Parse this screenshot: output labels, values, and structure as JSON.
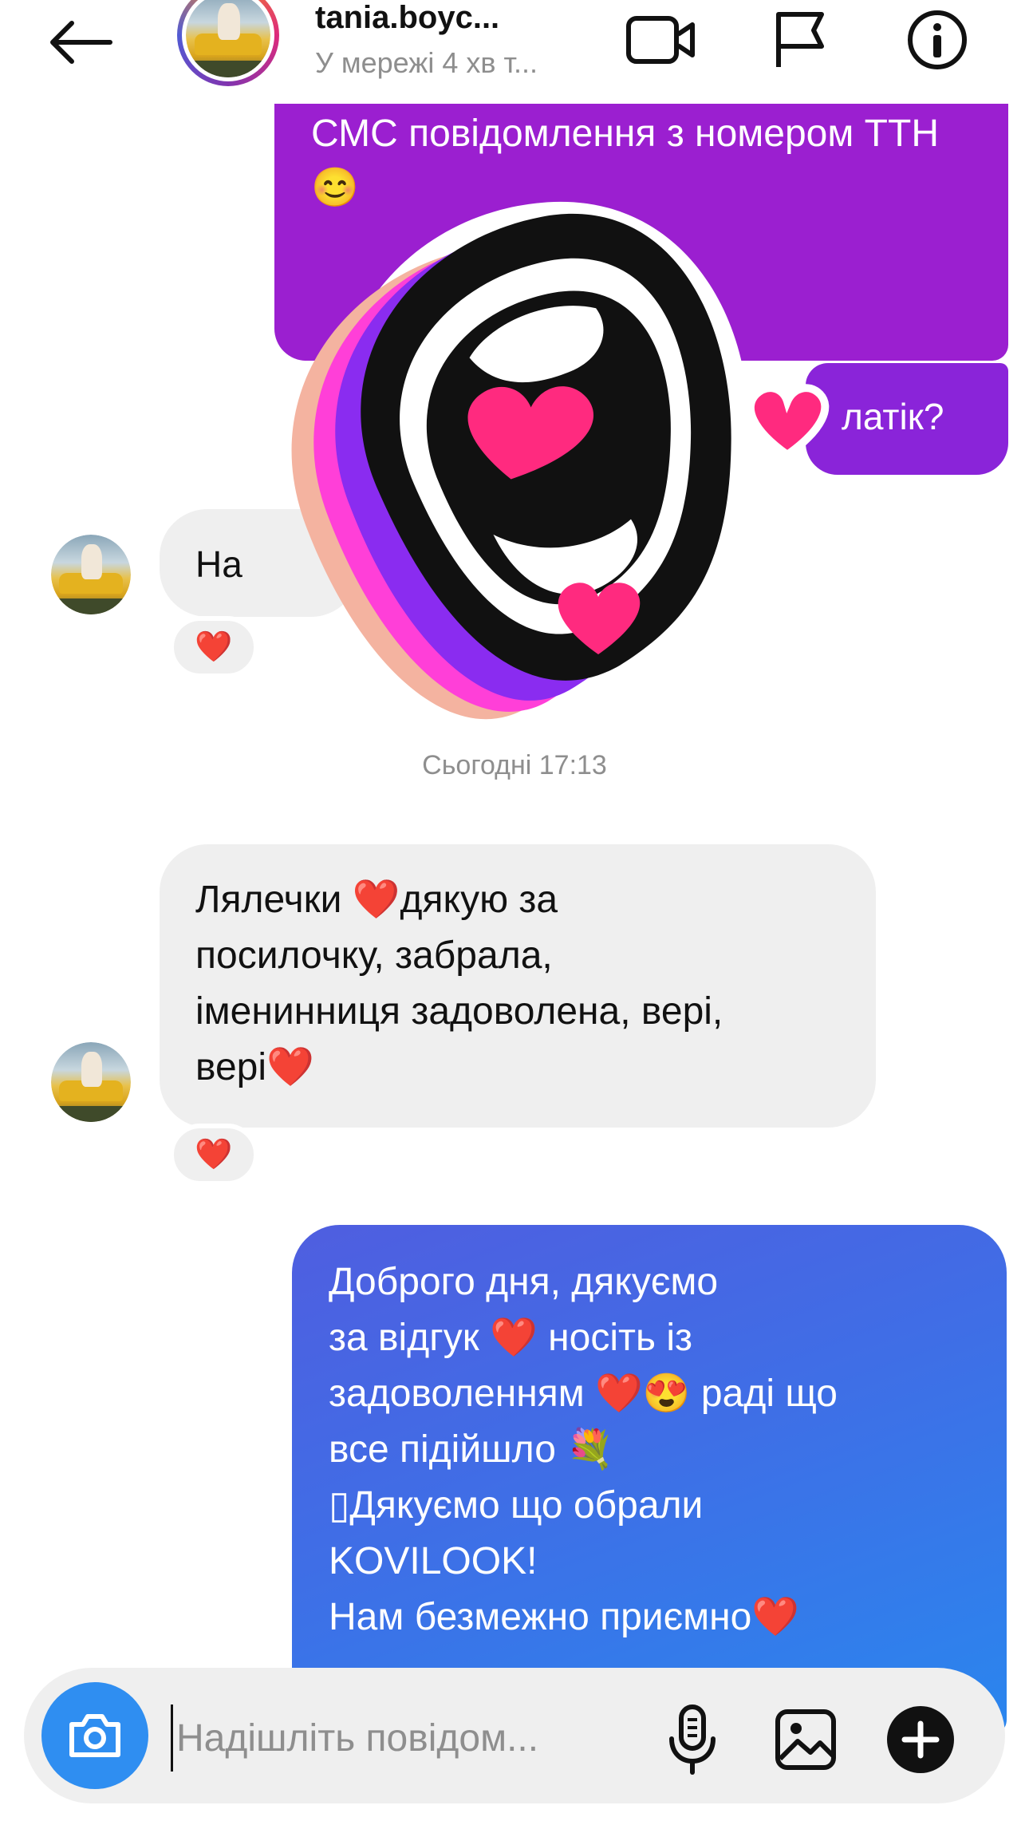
{
  "header": {
    "username": "tania.boyc...",
    "status": "У мережі 4 хв т...",
    "icons": [
      "back-arrow-icon",
      "video-call-icon",
      "flag-icon",
      "info-icon"
    ]
  },
  "thread": {
    "outgoing_top": {
      "text": "СМС повідомлення з номером ТТН 😊"
    },
    "outgoing_top2": {
      "text": "латік?"
    },
    "incoming_1": {
      "text": "На",
      "reaction": "❤️"
    },
    "timestamp": "Сьогодні 17:13",
    "incoming_2": {
      "text": "Лялечки ❤️дякую за\nпосилочку, забрала,\nіменинниця задоволена, вері,\nвері❤️",
      "reaction": "❤️"
    },
    "outgoing_2": {
      "text": "Доброго дня, дякуємо\nза відгук ❤️ носіть із\nзадоволенням ❤️😍 раді що\nвсе підійшло 💐\n▯Дякуємо що обрали\nKOVILOOK!\nНам безмежно приємно❤️"
    }
  },
  "composer": {
    "placeholder": "Надішліть повідом...",
    "icons": [
      "camera-icon",
      "microphone-icon",
      "gallery-icon",
      "plus-icon"
    ]
  },
  "colors": {
    "outgoing_purple": "#9b1fd0",
    "outgoing_blue": "#3f6ee6",
    "incoming_bubble": "#efefef",
    "camera_button": "#2f8ef1",
    "heart": "#e0192f",
    "sticker_pink": "#ff2a7f"
  }
}
